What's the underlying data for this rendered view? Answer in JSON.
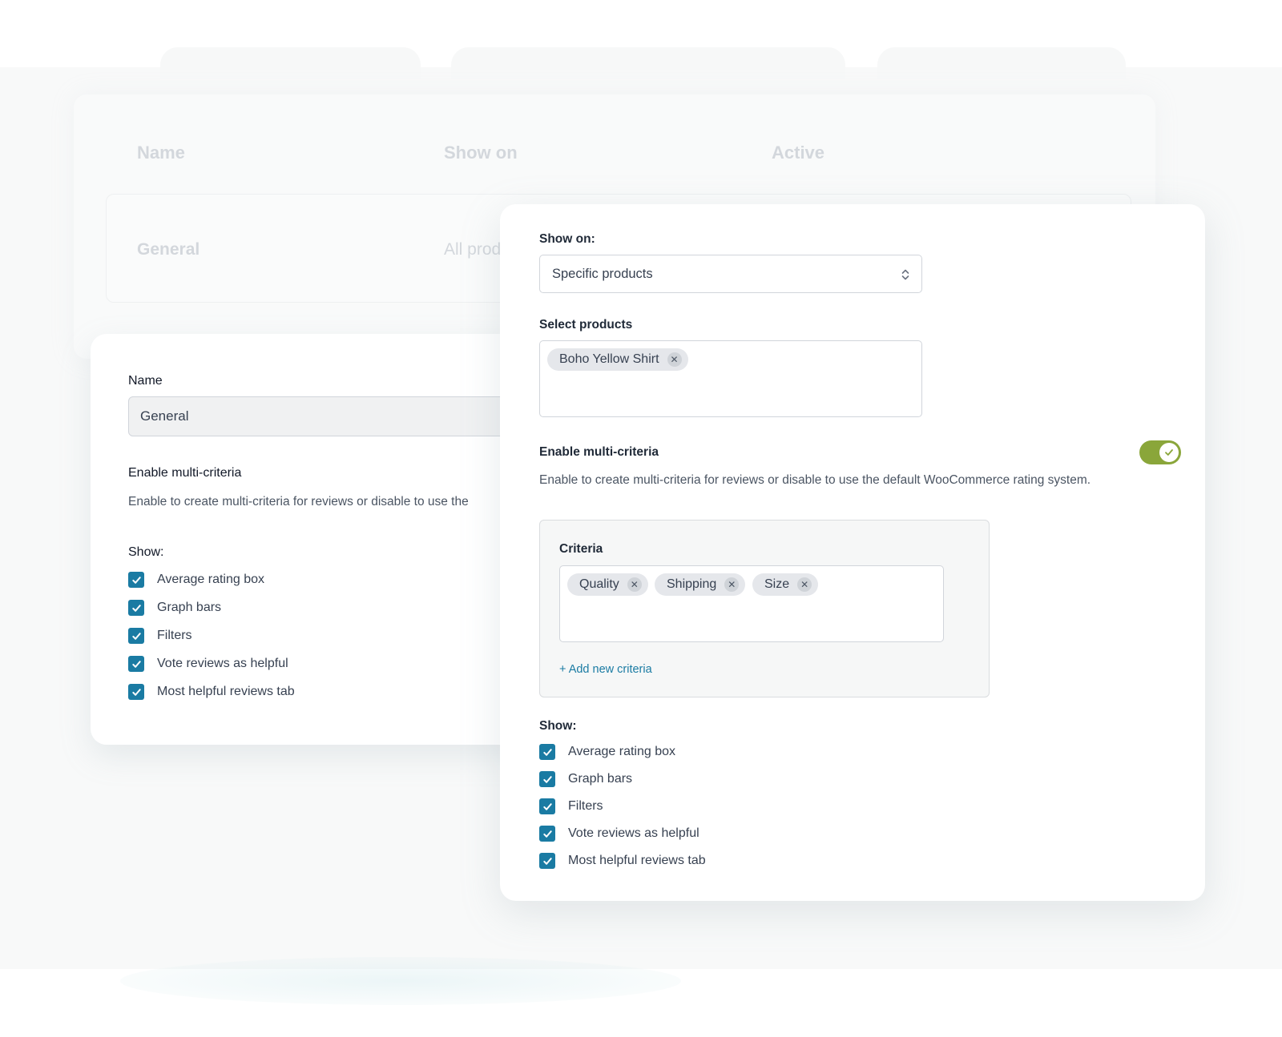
{
  "background": {
    "columns": [
      "Name",
      "Show on",
      "Active"
    ],
    "row": {
      "name": "General",
      "show_on": "All prod"
    }
  },
  "left_panel": {
    "name_label": "Name",
    "name_value": "General",
    "multi_criteria_label": "Enable multi-criteria",
    "multi_criteria_desc": "Enable to create multi-criteria for reviews or disable to use the",
    "show_label": "Show:",
    "show_items": [
      "Average rating box",
      "Graph bars",
      "Filters",
      "Vote reviews as helpful",
      "Most helpful reviews tab"
    ]
  },
  "right_panel": {
    "show_on_label": "Show on:",
    "show_on_value": "Specific products",
    "select_products_label": "Select products",
    "selected_products": [
      "Boho Yellow Shirt"
    ],
    "multi_criteria_label": "Enable multi-criteria",
    "multi_criteria_desc": "Enable to create multi-criteria for reviews or disable to use the default WooCommerce rating system.",
    "multi_criteria_enabled": true,
    "criteria_label": "Criteria",
    "criteria": [
      "Quality",
      "Shipping",
      "Size"
    ],
    "add_criteria_label": "+ Add new criteria",
    "show_label": "Show:",
    "show_items": [
      "Average rating box",
      "Graph bars",
      "Filters",
      "Vote reviews as helpful",
      "Most helpful reviews tab"
    ]
  },
  "colors": {
    "checkbox": "#1a7ba3",
    "toggle_on": "#8aa63a",
    "link": "#1a7ba3"
  },
  "icons": {
    "checkbox": "check-icon",
    "chip_remove": "close-icon",
    "select": "chevron-up-down-icon",
    "toggle": "check-icon"
  }
}
